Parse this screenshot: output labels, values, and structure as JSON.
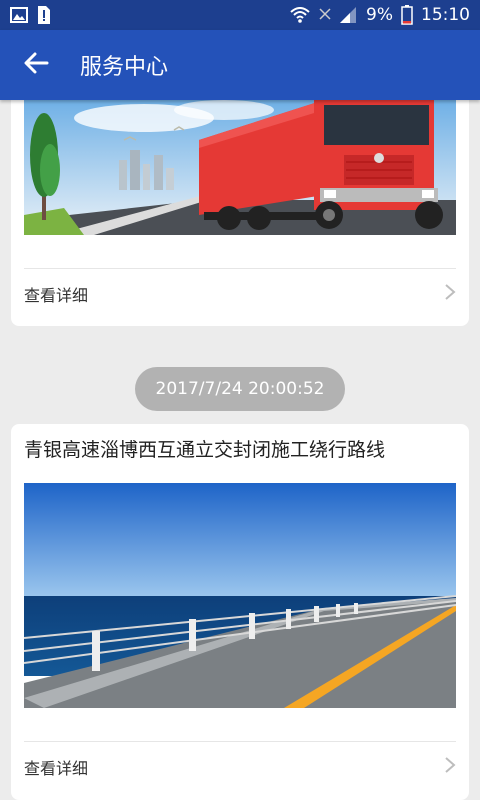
{
  "status_bar": {
    "battery": "9%",
    "time": "15:10",
    "left_icons": [
      "image-icon",
      "alert-icon"
    ],
    "right_icons": [
      "wifi-icon",
      "no-signal-icon",
      "signal-icon",
      "battery-icon"
    ]
  },
  "header": {
    "title": "服务中心",
    "back_icon": "back-arrow-icon",
    "background": "#2452b9"
  },
  "feed": {
    "card1": {
      "image": "red-truck-on-road",
      "detail_label": "查看详细"
    },
    "timestamp": "2017/7/24 20:00:52",
    "card2": {
      "title": "青银高速淄博西互通立交封闭施工绕行路线",
      "image": "highway-by-sea",
      "detail_label": "查看详细"
    }
  }
}
